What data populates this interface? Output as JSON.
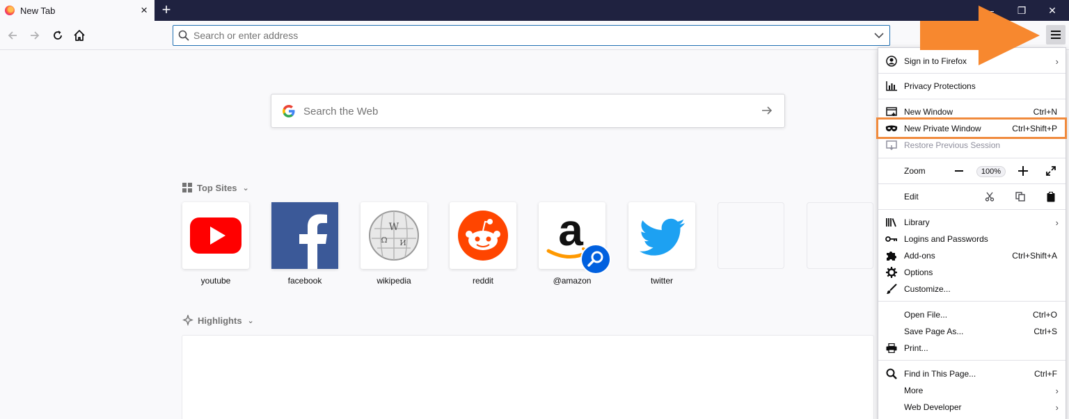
{
  "tab": {
    "title": "New Tab",
    "close": "×",
    "new_tab": "+"
  },
  "window_controls": {
    "minimize": "—",
    "restore": "❐",
    "close": "✕"
  },
  "urlbar": {
    "placeholder": "Search or enter address"
  },
  "websearch": {
    "placeholder": "Search the Web"
  },
  "top_sites": {
    "title": "Top Sites",
    "sites": [
      {
        "label": "youtube",
        "icon": "youtube-icon",
        "color": "#ff0000"
      },
      {
        "label": "facebook",
        "icon": "facebook-icon",
        "color": "#3b5998"
      },
      {
        "label": "wikipedia",
        "icon": "wikipedia-icon",
        "color": "#9a9a9a"
      },
      {
        "label": "reddit",
        "icon": "reddit-icon",
        "color": "#ff4500"
      },
      {
        "label": "@amazon",
        "icon": "amazon-icon",
        "color": "#000000"
      },
      {
        "label": "twitter",
        "icon": "twitter-icon",
        "color": "#1da1f2"
      }
    ]
  },
  "highlights": {
    "title": "Highlights"
  },
  "menu": {
    "sign_in": "Sign in to Firefox",
    "privacy": "Privacy Protections",
    "new_window": "New Window",
    "new_window_sc": "Ctrl+N",
    "private_window": "New Private Window",
    "private_window_sc": "Ctrl+Shift+P",
    "restore": "Restore Previous Session",
    "zoom": "Zoom",
    "zoom_level": "100%",
    "edit": "Edit",
    "library": "Library",
    "logins": "Logins and Passwords",
    "addons": "Add-ons",
    "addons_sc": "Ctrl+Shift+A",
    "options": "Options",
    "customize": "Customize...",
    "open_file": "Open File...",
    "open_file_sc": "Ctrl+O",
    "save_page": "Save Page As...",
    "save_page_sc": "Ctrl+S",
    "print": "Print...",
    "find": "Find in This Page...",
    "find_sc": "Ctrl+F",
    "more": "More",
    "web_dev": "Web Developer"
  },
  "colors": {
    "accent": "#f08a3c",
    "tabstrip": "#1f2240",
    "focus": "#1f6fb2"
  }
}
